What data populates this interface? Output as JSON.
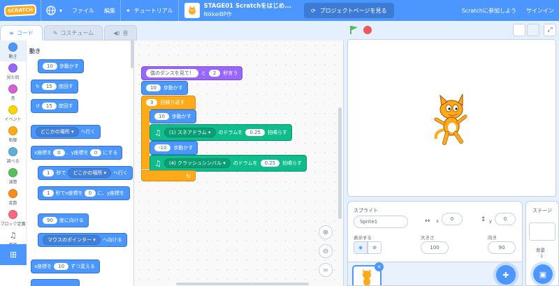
{
  "menubar": {
    "logo": "SCRATCH",
    "file": "ファイル",
    "edit": "編集",
    "tutorials": "チュートリアル",
    "project_title": "STAGE01 Scratchをはじめ...",
    "author": "NikkeiBP作",
    "see_project_page": "プロジェクトページを見る",
    "join": "Scratchに参加しよう",
    "signin": "サインイン"
  },
  "tabs": {
    "code": "コード",
    "costumes": "コスチューム",
    "sounds": "音"
  },
  "categories": [
    {
      "label": "動き",
      "color": "#4c97ff"
    },
    {
      "label": "見た目",
      "color": "#9966ff"
    },
    {
      "label": "音",
      "color": "#cf63cf"
    },
    {
      "label": "イベント",
      "color": "#ffd500"
    },
    {
      "label": "制御",
      "color": "#ffab19"
    },
    {
      "label": "調べる",
      "color": "#5cb1d6"
    },
    {
      "label": "演算",
      "color": "#59c059"
    },
    {
      "label": "変数",
      "color": "#ff8c1a"
    },
    {
      "label": "ブロック定義",
      "color": "#ff6680"
    },
    {
      "label": "音楽",
      "color": "#0fbd8c"
    }
  ],
  "palette": {
    "title": "動き",
    "move_steps": "10",
    "move_label": "歩動かす",
    "turn_right_deg": "15",
    "turn_right_label": "度回す",
    "turn_left_deg": "15",
    "turn_left_label": "度回す",
    "goto_target": "どこかの場所",
    "goto_label": "へ行く",
    "gotoxy_xlabel": "x座標を",
    "gotoxy_x": "0",
    "gotoxy_ylabel": "、y座標を",
    "gotoxy_y": "0",
    "gotoxy_label": "にする",
    "glide_secs": "1",
    "glide_mid": "秒で",
    "glide_target": "どこかの場所",
    "glide_label": "へ行く",
    "glidexy_secs": "1",
    "glidexy_mid": "秒でx座標を",
    "glidexy_x": "0",
    "glidexy_ylabel": "に、y座標を",
    "point_dir": "90",
    "point_label": "度に向ける",
    "point_towards": "マウスのポインター",
    "point_towards_label": "へ向ける",
    "changex_label": "x座標を",
    "changex_val": "10",
    "changex_suffix": "ずつ変える"
  },
  "script": {
    "say_text": "僕のダンスを見て！",
    "say_and": "と",
    "say_secs": "2",
    "say_suffix": "秒言う",
    "move1": "10",
    "move1_label": "歩動かす",
    "repeat_n": "3",
    "repeat_label": "回繰り返す",
    "move2": "10",
    "move2_label": "歩動かす",
    "drum1": "(1) スネアドラム",
    "drum1_mid": "のドラムを",
    "drum1_beats": "0.25",
    "drum1_label": "拍鳴らす",
    "move3": "-10",
    "move3_label": "歩動かす",
    "drum2": "(4) クラッシュシンバル",
    "drum2_mid": "のドラムを",
    "drum2_beats": "0.25",
    "drum2_label": "拍鳴らす",
    "loop_arrow": "↻"
  },
  "sprite": {
    "header": "スプライト",
    "name": "Sprite1",
    "x_label": "x",
    "x": "0",
    "y_label": "y",
    "y": "0",
    "show_label": "表示する",
    "size_label": "大きさ",
    "size": "100",
    "direction_label": "向き",
    "direction": "90"
  },
  "stage_pane": {
    "title": "ステージ",
    "backdrops_label": "背景",
    "backdrops_count": "1"
  }
}
